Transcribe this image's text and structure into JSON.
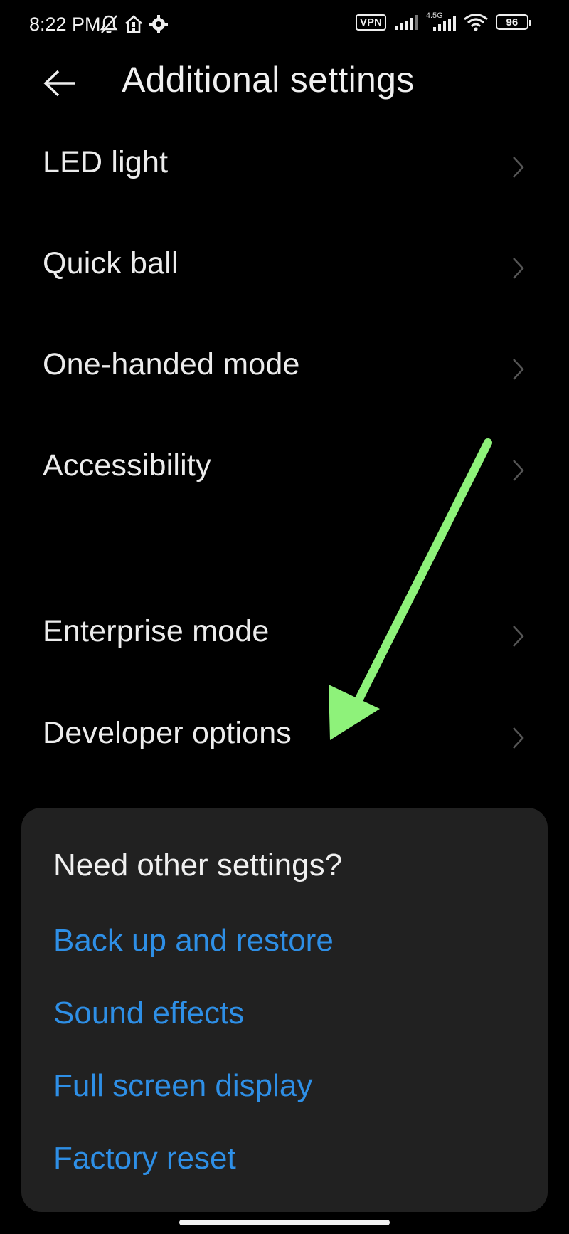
{
  "status_bar": {
    "time": "8:22 PM",
    "left_icons": [
      "bell-off-icon",
      "home-alert-icon",
      "gear-icon"
    ],
    "vpn": "VPN",
    "network_label": "4.5G",
    "battery": "96"
  },
  "header": {
    "back_icon": "arrow-left-icon",
    "title": "Additional settings"
  },
  "menu": {
    "items": [
      {
        "label": "LED light"
      },
      {
        "label": "Quick ball"
      },
      {
        "label": "One-handed mode"
      },
      {
        "label": "Accessibility"
      },
      {
        "label": "Enterprise mode"
      },
      {
        "label": "Developer options"
      }
    ]
  },
  "other_settings": {
    "title": "Need other settings?",
    "links": [
      {
        "label": "Back up and restore"
      },
      {
        "label": "Sound effects"
      },
      {
        "label": "Full screen display"
      },
      {
        "label": "Factory reset"
      }
    ]
  },
  "annotation": {
    "arrow_color": "#8ef27a"
  },
  "colors": {
    "background": "#000000",
    "card": "#212121",
    "link": "#2e8fe6"
  }
}
